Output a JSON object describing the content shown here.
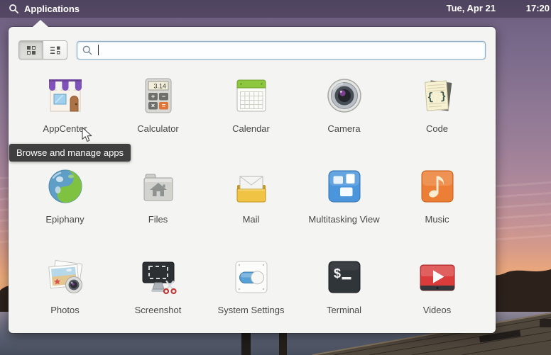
{
  "panel": {
    "menu_label": "Applications",
    "date": "Tue, Apr 21",
    "time": "17:20"
  },
  "launcher": {
    "search": {
      "value": "",
      "placeholder": ""
    },
    "calc": {
      "display": "3.14",
      "buttons": [
        "+",
        "−",
        "×",
        "="
      ]
    },
    "code_glyph": "{ }",
    "terminal_prompt": "$",
    "apps": [
      {
        "label": "AppCenter"
      },
      {
        "label": "Calculator"
      },
      {
        "label": "Calendar"
      },
      {
        "label": "Camera"
      },
      {
        "label": "Code"
      },
      {
        "label": "Epiphany"
      },
      {
        "label": "Files"
      },
      {
        "label": "Mail"
      },
      {
        "label": "Multitasking View"
      },
      {
        "label": "Music"
      },
      {
        "label": "Photos"
      },
      {
        "label": "Screenshot"
      },
      {
        "label": "System Settings"
      },
      {
        "label": "Terminal"
      },
      {
        "label": "Videos"
      }
    ]
  },
  "tooltip": {
    "text": "Browse and manage apps"
  },
  "icons": {
    "panel_search": "magnifier",
    "entry_search": "magnifier",
    "grid_view": "grid-of-squares",
    "category_view": "list-with-squares",
    "pointer": "arrow-cursor"
  },
  "colors": {
    "panel_bg": "rgba(40,33,52,0.40)",
    "launcher_bg": "#f4f4f3",
    "tooltip_bg": "rgba(48,48,48,0.93)",
    "search_border": "#8fb0c6",
    "accent_blue": "#4b95dc",
    "accent_orange": "#ec7f35",
    "accent_red": "#da3c3c"
  }
}
